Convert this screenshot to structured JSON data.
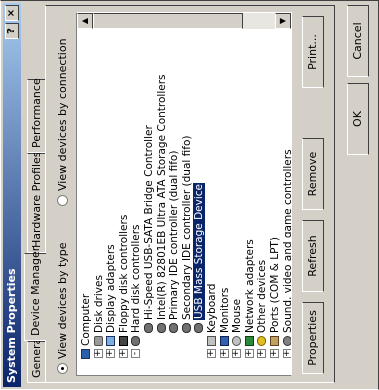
{
  "window": {
    "title": "System Properties",
    "help_glyph": "?",
    "close_glyph": "×"
  },
  "tabs": [
    {
      "label": "General",
      "active": false
    },
    {
      "label": "Device Manager",
      "active": true
    },
    {
      "label": "Hardware Profiles",
      "active": false
    },
    {
      "label": "Performance",
      "active": false
    }
  ],
  "view": {
    "by_type": "View devices by type",
    "by_connection": "View devices by connection",
    "selected": "by_type"
  },
  "tree": [
    {
      "label": "Computer",
      "indent": 0,
      "toggle": "",
      "icon": "computer-icon"
    },
    {
      "label": "Disk drives",
      "indent": 1,
      "toggle": "+",
      "icon": "disk-drive-icon"
    },
    {
      "label": "Display adapters",
      "indent": 1,
      "toggle": "+",
      "icon": "display-adapter-icon"
    },
    {
      "label": "Floppy disk controllers",
      "indent": 1,
      "toggle": "+",
      "icon": "floppy-controller-icon"
    },
    {
      "label": "Hard disk controllers",
      "indent": 1,
      "toggle": "-",
      "icon": "hard-disk-controller-icon"
    },
    {
      "label": "Hi-Speed USB-SATA Bridge Controller",
      "indent": 2,
      "toggle": "",
      "icon": "ide-controller-icon"
    },
    {
      "label": "Intel(R) 82801EB Ultra ATA Storage Controllers",
      "indent": 2,
      "toggle": "",
      "icon": "ide-controller-icon"
    },
    {
      "label": "Primary IDE controller (dual fifo)",
      "indent": 2,
      "toggle": "",
      "icon": "ide-controller-icon"
    },
    {
      "label": "Secondary IDE controller (dual fifo)",
      "indent": 2,
      "toggle": "",
      "icon": "ide-controller-icon"
    },
    {
      "label": "USB Mass Storage Device",
      "indent": 2,
      "toggle": "",
      "icon": "ide-controller-icon",
      "selected": true
    },
    {
      "label": "Keyboard",
      "indent": 1,
      "toggle": "+",
      "icon": "keyboard-icon"
    },
    {
      "label": "Monitors",
      "indent": 1,
      "toggle": "+",
      "icon": "monitor-icon"
    },
    {
      "label": "Mouse",
      "indent": 1,
      "toggle": "+",
      "icon": "mouse-icon"
    },
    {
      "label": "Network adapters",
      "indent": 1,
      "toggle": "+",
      "icon": "network-adapter-icon"
    },
    {
      "label": "Other devices",
      "indent": 1,
      "toggle": "+",
      "icon": "other-devices-icon"
    },
    {
      "label": "Ports (COM & LPT)",
      "indent": 1,
      "toggle": "+",
      "icon": "ports-icon"
    },
    {
      "label": "Sound, video and game controllers",
      "indent": 1,
      "toggle": "+",
      "icon": "sound-controller-icon"
    }
  ],
  "buttons": {
    "properties": "Properties",
    "refresh": "Refresh",
    "remove": "Remove",
    "print": "Print...",
    "ok": "OK",
    "cancel": "Cancel"
  },
  "colors": {
    "titlebar_start": "#0a246a",
    "titlebar_end": "#a6caf0",
    "face": "#d4d0c8",
    "selection": "#0a246a"
  }
}
